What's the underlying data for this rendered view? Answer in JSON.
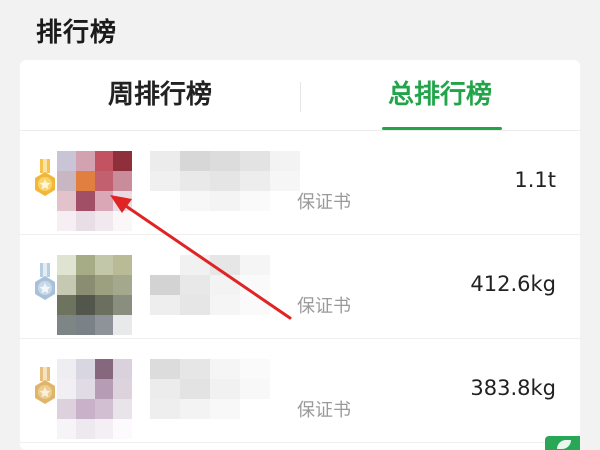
{
  "page": {
    "title": "排行榜"
  },
  "tabs": [
    {
      "label": "周排行榜",
      "active": false
    },
    {
      "label": "总排行榜",
      "active": true
    }
  ],
  "colors": {
    "accent": "#22a54a",
    "gold": "#f2b73a",
    "silver": "#a8c1d8",
    "bronze": "#e0b56b"
  },
  "rows": [
    {
      "cert_text": "保证书",
      "value": "1.1t",
      "medal": "gold-medal-icon"
    },
    {
      "cert_text": "保证书",
      "value": "412.6kg",
      "medal": "silver-medal-icon"
    },
    {
      "cert_text": "保证书",
      "value": "383.8kg",
      "medal": "bronze-medal-icon"
    }
  ],
  "annotation": {
    "type": "red-arrow",
    "target": "first avatar"
  }
}
